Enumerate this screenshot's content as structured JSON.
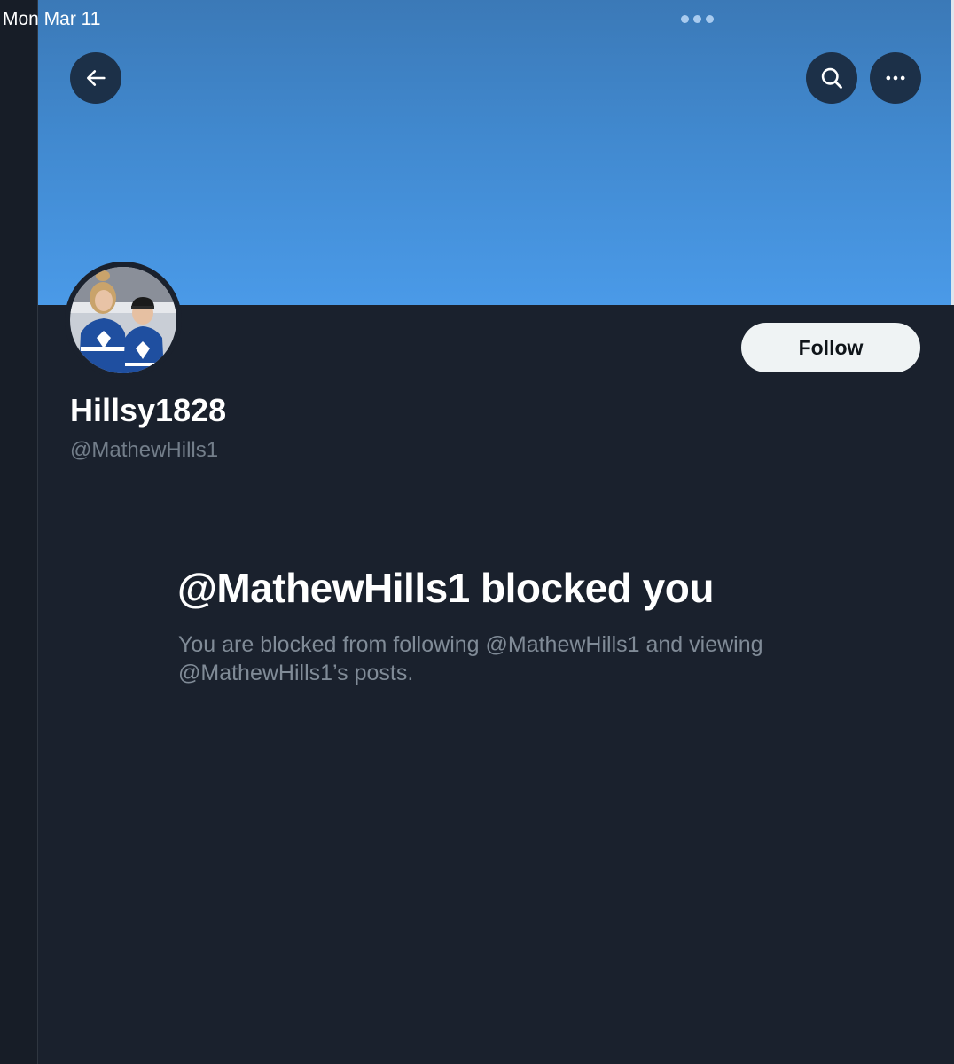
{
  "status_bar": {
    "date": "Mon Mar 11"
  },
  "header": {
    "back_icon": "arrow-left-icon",
    "search_icon": "search-icon",
    "more_icon": "more-horizontal-icon"
  },
  "profile": {
    "display_name": "Hillsy1828",
    "handle": "@MathewHills1",
    "follow_label": "Follow"
  },
  "blocked": {
    "title": "@MathewHills1 blocked you",
    "message": "You are blocked from following @MathewHills1 and viewing @MathewHills1’s posts."
  },
  "colors": {
    "background": "#1a212d",
    "banner": "#4a9ae8",
    "header_button": "#1c3048",
    "follow_button": "#eff3f4",
    "secondary_text": "#808b97"
  }
}
